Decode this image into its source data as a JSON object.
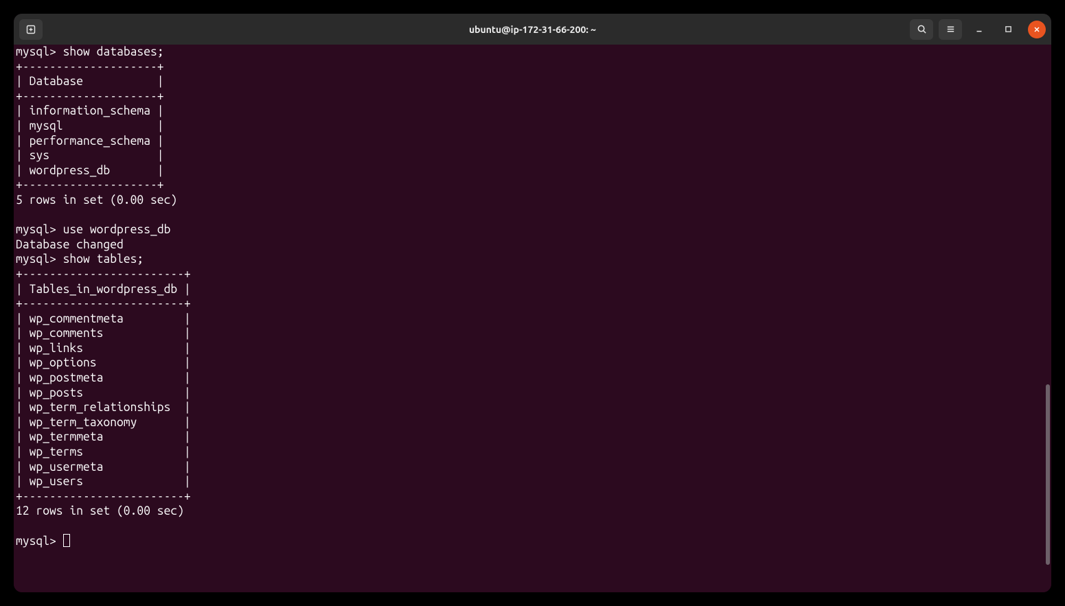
{
  "window": {
    "title": "ubuntu@ip-172-31-66-200: ~"
  },
  "prompts": {
    "mysql": "mysql>"
  },
  "commands": {
    "show_databases": "show databases;",
    "use_db": "use wordpress_db",
    "show_tables": "show tables;"
  },
  "responses": {
    "db_changed": "Database changed"
  },
  "db_table": {
    "border": "+--------------------+",
    "header": "| Database           |",
    "rows": [
      "| information_schema |",
      "| mysql              |",
      "| performance_schema |",
      "| sys                |",
      "| wordpress_db       |"
    ],
    "footer": "5 rows in set (0.00 sec)"
  },
  "tbl_table": {
    "border": "+------------------------+",
    "header": "| Tables_in_wordpress_db |",
    "rows": [
      "| wp_commentmeta         |",
      "| wp_comments            |",
      "| wp_links               |",
      "| wp_options             |",
      "| wp_postmeta            |",
      "| wp_posts               |",
      "| wp_term_relationships  |",
      "| wp_term_taxonomy       |",
      "| wp_termmeta            |",
      "| wp_terms               |",
      "| wp_usermeta            |",
      "| wp_users               |"
    ],
    "footer": "12 rows in set (0.00 sec)"
  }
}
